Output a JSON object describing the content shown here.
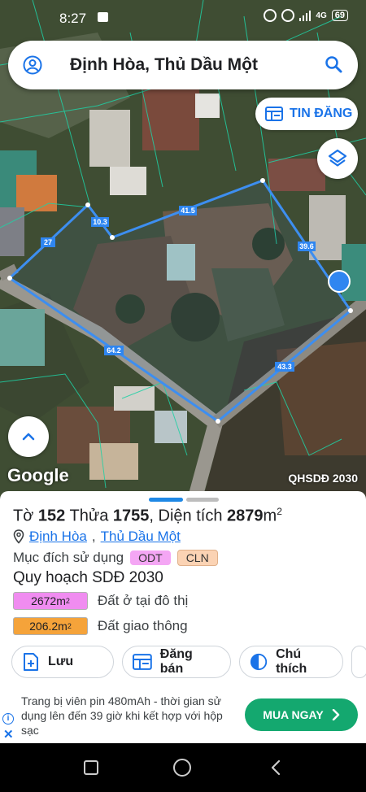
{
  "status_bar": {
    "time": "8:27",
    "network": "4G",
    "battery": "69"
  },
  "search": {
    "title": "Định Hòa, Thủ Dầu Một",
    "icons": [
      "user-icon",
      "search-icon"
    ]
  },
  "map": {
    "tin_dang_label": "TIN ĐĂNG",
    "google_label": "Google",
    "overlay_label": "QHSDĐ 2030",
    "edges": [
      "41.5",
      "10.3",
      "27",
      "39.6",
      "64.2",
      "43.3"
    ],
    "boundary_color": "#3d8ef0"
  },
  "parcel": {
    "to_label": "Tờ",
    "to_value": "152",
    "thua_label": "Thửa",
    "thua_value": "1755",
    "dien_tich_label": "Diện tích",
    "area_value": "2879",
    "area_unit": "m",
    "area_sup": "2",
    "ward": "Định Hòa",
    "city": "Thủ Dầu Một",
    "purpose_label": "Mục đích sử dụng",
    "purpose_tags": [
      "ODT",
      "CLN"
    ],
    "plan_label": "Quy hoạch SDĐ 2030",
    "plan_rows": [
      {
        "area": "2672m",
        "sup": "2",
        "desc": "Đất ở tại đô thị",
        "color": "#f08cf0"
      },
      {
        "area": "206.2m",
        "sup": "2",
        "desc": "Đất giao thông",
        "color": "#f5a33a"
      }
    ]
  },
  "actions": {
    "save": "Lưu",
    "sell": "Đăng bán",
    "legend": "Chú thích"
  },
  "ad": {
    "text": "Trang bị viên pin 480mAh - thời gian sử dụng lên đến 39 giờ khi kết hợp với hộp sạc",
    "cta": "MUA NGAY"
  },
  "colors": {
    "accent": "#1a73e8",
    "cta": "#14a86f",
    "tag_odt": "#f4a6f4",
    "tag_cln": "#fbd3b4"
  }
}
